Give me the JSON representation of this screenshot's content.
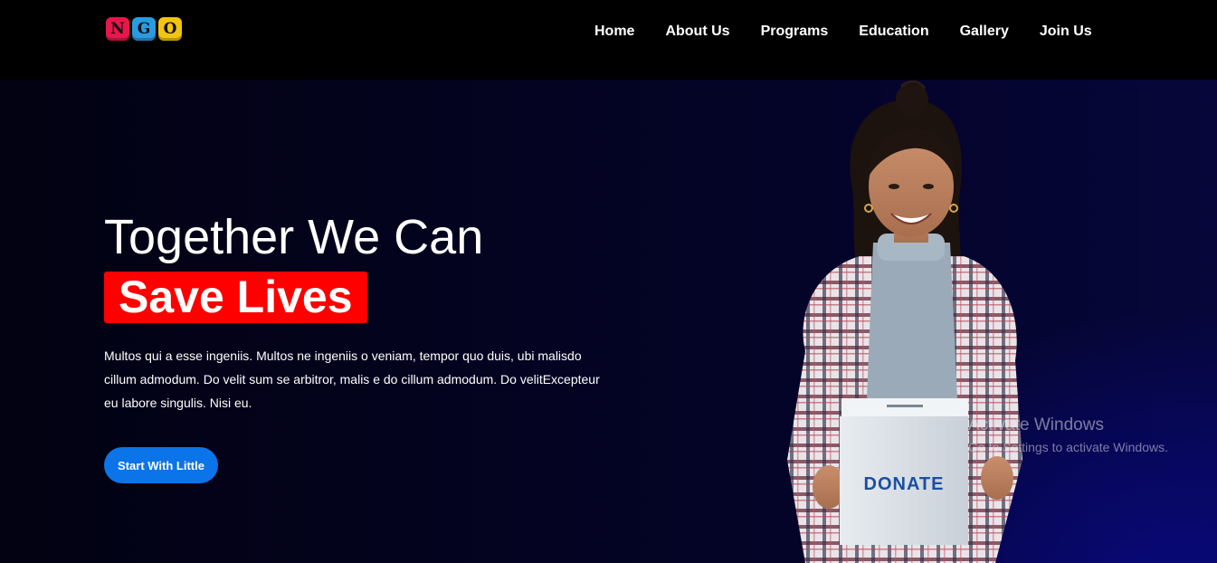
{
  "logo": {
    "letters": [
      "N",
      "G",
      "O"
    ],
    "colors": [
      "#e8174b",
      "#2a9be0",
      "#f1c40f"
    ]
  },
  "nav": {
    "items": [
      "Home",
      "About Us",
      "Programs",
      "Education",
      "Gallery",
      "Join Us"
    ]
  },
  "hero": {
    "title_line1": "Together We Can",
    "title_line2": "Save Lives",
    "description": "Multos qui a esse ingeniis. Multos ne ingeniis o veniam, tempor quo duis, ubi malisdo cillum admodum. Do velit sum se arbitror, malis e do cillum admodum. Do velitExcepteur eu labore singulis. Nisi eu.",
    "cta_label": "Start With Little",
    "box_label": "DONATE"
  },
  "watermark": {
    "title": "Activate Windows",
    "subtitle": "Go to Settings to activate Windows."
  },
  "colors": {
    "accent_red": "#ff0000",
    "cta_blue": "#0a74e8",
    "header_bg": "#000000",
    "hero_bg": "#040320"
  }
}
